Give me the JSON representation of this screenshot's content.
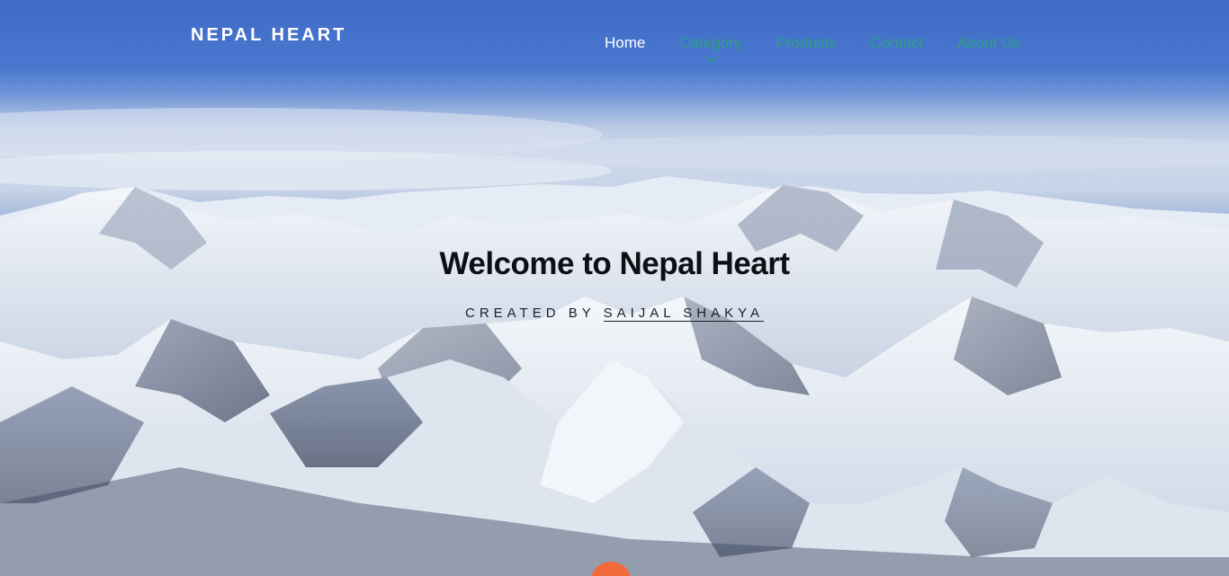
{
  "brand": {
    "name": "NEPAL HEART"
  },
  "nav": {
    "items": [
      {
        "label": "Home",
        "active": true
      },
      {
        "label": "Category",
        "has_dropdown": true
      },
      {
        "label": "Products"
      },
      {
        "label": "Contact"
      },
      {
        "label": "About Us"
      }
    ]
  },
  "hero": {
    "title": "Welcome to Nepal Heart",
    "subtitle_prefix": "CREATED BY ",
    "author": "SAIJAL SHAKYA",
    "background": "himalaya-mountain-panorama"
  },
  "colors": {
    "nav_link": "#2e9e86",
    "nav_active": "#ffffff",
    "scroll_button": "#f06a3c"
  },
  "icons": {
    "dropdown": "chevron-down-icon"
  }
}
